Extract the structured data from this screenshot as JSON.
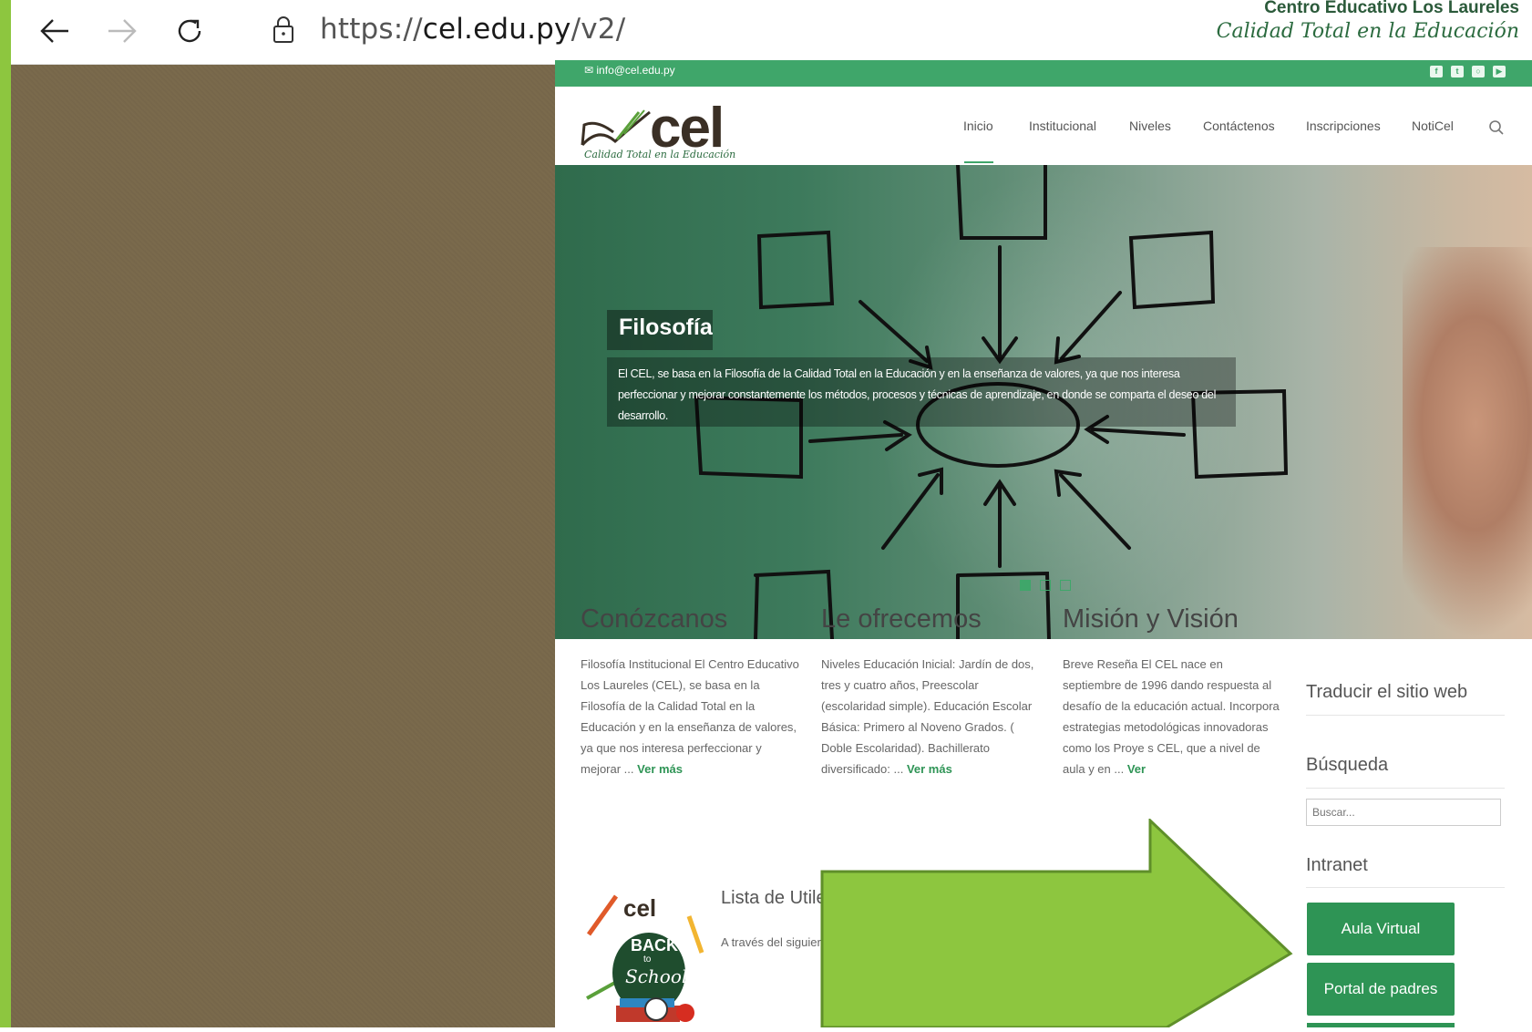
{
  "browser": {
    "url_scheme": "https://",
    "url_host": "cel.edu.py",
    "url_path": "/v2/"
  },
  "brand_overlay": {
    "name": "Centro Educativo Los Laureles",
    "tagline": "Calidad Total en la Educación"
  },
  "topbar": {
    "email": "info@cel.edu.py",
    "social_icons": [
      "facebook-icon",
      "twitter-icon",
      "instagram-icon",
      "youtube-icon"
    ]
  },
  "logo": {
    "text": "cel",
    "tagline": "Calidad Total en la Educación"
  },
  "menu": {
    "items": [
      "Inicio",
      "Institucional",
      "Niveles",
      "Contáctenos",
      "Inscripciones",
      "NotiCel"
    ],
    "active": "Inicio"
  },
  "hero": {
    "title": "Filosofía",
    "text": "El CEL, se basa en la Filosofía de la Calidad Total en la Educación y en la enseñanza de valores, ya que nos interesa perfeccionar y mejorar constantemente los métodos, procesos y técnicas de aprendizaje, en donde se comparta el deseo del desarrollo.",
    "slide_count": 3,
    "active_slide": 1
  },
  "columns": [
    {
      "title": "Conózcanos",
      "text": "Filosofía Institucional El Centro Educativo Los Laureles (CEL), se basa en la Filosofía de la Calidad Total en la Educación y en la enseñanza de valores, ya que nos interesa perfeccionar y mejorar ...",
      "link": "Ver más"
    },
    {
      "title": "Le ofrecemos",
      "text": "Niveles Educación Inicial: Jardín de dos, tres y cuatro años, Preescolar (escolaridad simple). Educación Escolar Básica: Primero al Noveno Grados. ( Doble Escolaridad). Bachillerato diversificado: ...",
      "link": "Ver más"
    },
    {
      "title": "Misión y Visión",
      "text": "Breve Reseña El CEL nace en septiembre de 1996 dando respuesta al desafío de la educación actual. Incorpora estrategias metodológicas innovadoras como los Proye  s CEL, que a nivel de aula y en  ...",
      "link": "Ver"
    }
  ],
  "sidebar": {
    "translate_title": "Traducir el sitio web",
    "search_title": "Búsqueda",
    "search_placeholder": "Buscar...",
    "intranet_title": "Intranet",
    "buttons": [
      "Aula Virtual",
      "Portal de padres"
    ]
  },
  "utiles": {
    "title": "Lista de Utile",
    "text": "A través del siguier",
    "image_text": [
      "cel",
      "BACK",
      "to",
      "School"
    ]
  },
  "colors": {
    "accent_green": "#3fa66a",
    "button_green": "#2e9455",
    "arrow_green": "#8dc63f",
    "arrow_border": "#5f8f2a",
    "brown_panel": "#7a6a4c"
  }
}
